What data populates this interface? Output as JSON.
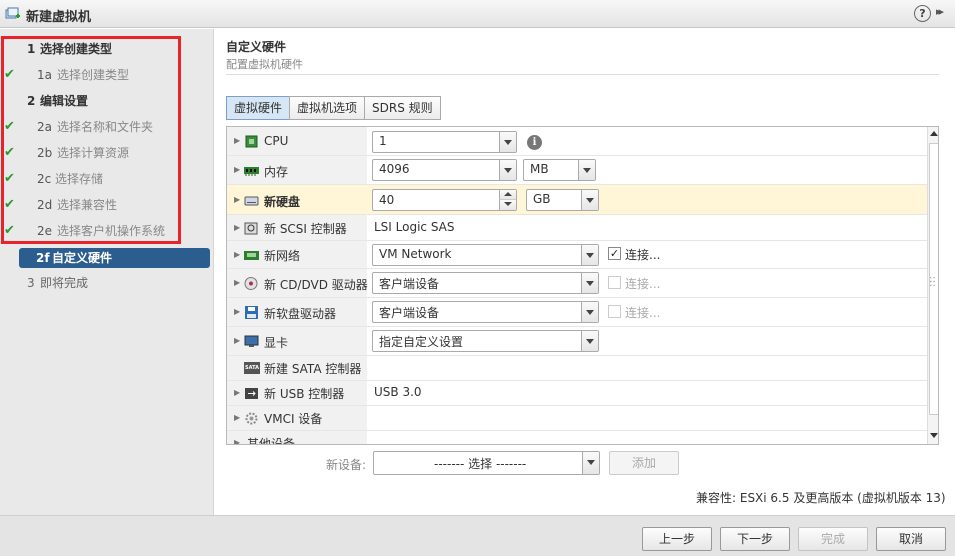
{
  "window": {
    "title": "新建虚拟机",
    "help": "?",
    "expand": "▸▸"
  },
  "sidebar": {
    "steps": [
      {
        "num": "1",
        "label": "选择创建类型",
        "kind": "main"
      },
      {
        "num": "1a",
        "label": "选择创建类型",
        "kind": "sub",
        "done": true
      },
      {
        "num": "2",
        "label": "编辑设置",
        "kind": "main"
      },
      {
        "num": "2a",
        "label": "选择名称和文件夹",
        "kind": "sub",
        "done": true
      },
      {
        "num": "2b",
        "label": "选择计算资源",
        "kind": "sub",
        "done": true
      },
      {
        "num": "2c",
        "label": "选择存储",
        "kind": "sub",
        "done": true
      },
      {
        "num": "2d",
        "label": "选择兼容性",
        "kind": "sub",
        "done": true
      },
      {
        "num": "2e",
        "label": "选择客户机操作系统",
        "kind": "sub",
        "done": true
      },
      {
        "num": "2f",
        "label": "自定义硬件",
        "kind": "active"
      },
      {
        "num": "3",
        "label": "即将完成",
        "kind": "pending"
      }
    ],
    "check_glyph": "✔"
  },
  "header": {
    "title": "自定义硬件",
    "subtitle": "配置虚拟机硬件"
  },
  "tabs": [
    "虚拟硬件",
    "虚拟机选项",
    "SDRS 规则"
  ],
  "hardware": {
    "cpu": {
      "name": "CPU",
      "value": "1",
      "info": "i"
    },
    "memory": {
      "name": "内存",
      "value": "4096",
      "unit": "MB"
    },
    "disk": {
      "name": "新硬盘",
      "value": "40",
      "unit": "GB"
    },
    "scsi": {
      "name": "新 SCSI 控制器",
      "value": "LSI Logic SAS"
    },
    "network": {
      "name": "新网络",
      "value": "VM Network",
      "connect": "连接...",
      "connected": "✓"
    },
    "cddvd": {
      "name": "新 CD/DVD 驱动器",
      "value": "客户端设备",
      "connect": "连接..."
    },
    "floppy": {
      "name": "新软盘驱动器",
      "value": "客户端设备",
      "connect": "连接..."
    },
    "video": {
      "name": "显卡",
      "value": "指定自定义设置"
    },
    "sata": {
      "name": "新建 SATA 控制器",
      "icon_text": "SATA"
    },
    "usb": {
      "name": "新 USB 控制器",
      "value": "USB 3.0"
    },
    "vmci": {
      "name": "VMCI 设备"
    },
    "other": {
      "name": "其他设备"
    }
  },
  "new_device": {
    "label": "新设备:",
    "select": "------- 选择 -------",
    "add": "添加"
  },
  "compat": "兼容性: ESXi 6.5 及更高版本 (虚拟机版本 13)",
  "footer": {
    "back": "上一步",
    "next": "下一步",
    "finish": "完成",
    "cancel": "取消"
  },
  "colors": {
    "active_step": "#2c5d8f",
    "highlight_box": "#e8232a",
    "done_check": "#2a9a2a"
  }
}
